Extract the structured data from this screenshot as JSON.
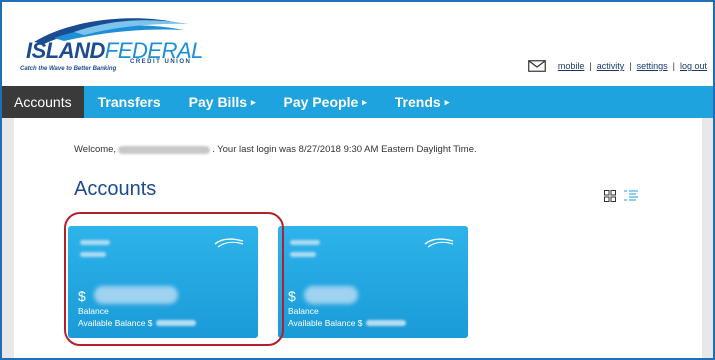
{
  "brand": {
    "name_bold": "ISLAND",
    "name_light": "FEDERAL",
    "sub": "CREDIT UNION",
    "tagline": "Catch the Wave to Better Banking",
    "color_dark": "#1b4b91",
    "color_light": "#1d8fd6"
  },
  "top_links": {
    "icon": "mail-icon",
    "items": [
      "mobile",
      "activity",
      "settings",
      "log out"
    ]
  },
  "nav": {
    "items": [
      {
        "label": "Accounts",
        "active": true,
        "caret": ""
      },
      {
        "label": "Transfers",
        "active": false,
        "caret": ""
      },
      {
        "label": "Pay Bills",
        "active": false,
        "caret": "▸"
      },
      {
        "label": "Pay People",
        "active": false,
        "caret": "▸"
      },
      {
        "label": "Trends",
        "active": false,
        "caret": "▸"
      }
    ],
    "color": "#1ea3de",
    "active_color": "#3a3a3a"
  },
  "welcome": {
    "prefix": "Welcome,",
    "suffix": ". Your last login was 8/27/2018 9:30 AM Eastern Daylight Time."
  },
  "section_title": "Accounts",
  "view_icons": [
    "grid-view-icon",
    "list-view-icon"
  ],
  "cards": [
    {
      "currency": "$",
      "balance_label": "Balance",
      "available_label": "Available Balance $"
    },
    {
      "currency": "$",
      "balance_label": "Balance",
      "available_label": "Available Balance $"
    }
  ],
  "highlight_color": "#b3202b"
}
